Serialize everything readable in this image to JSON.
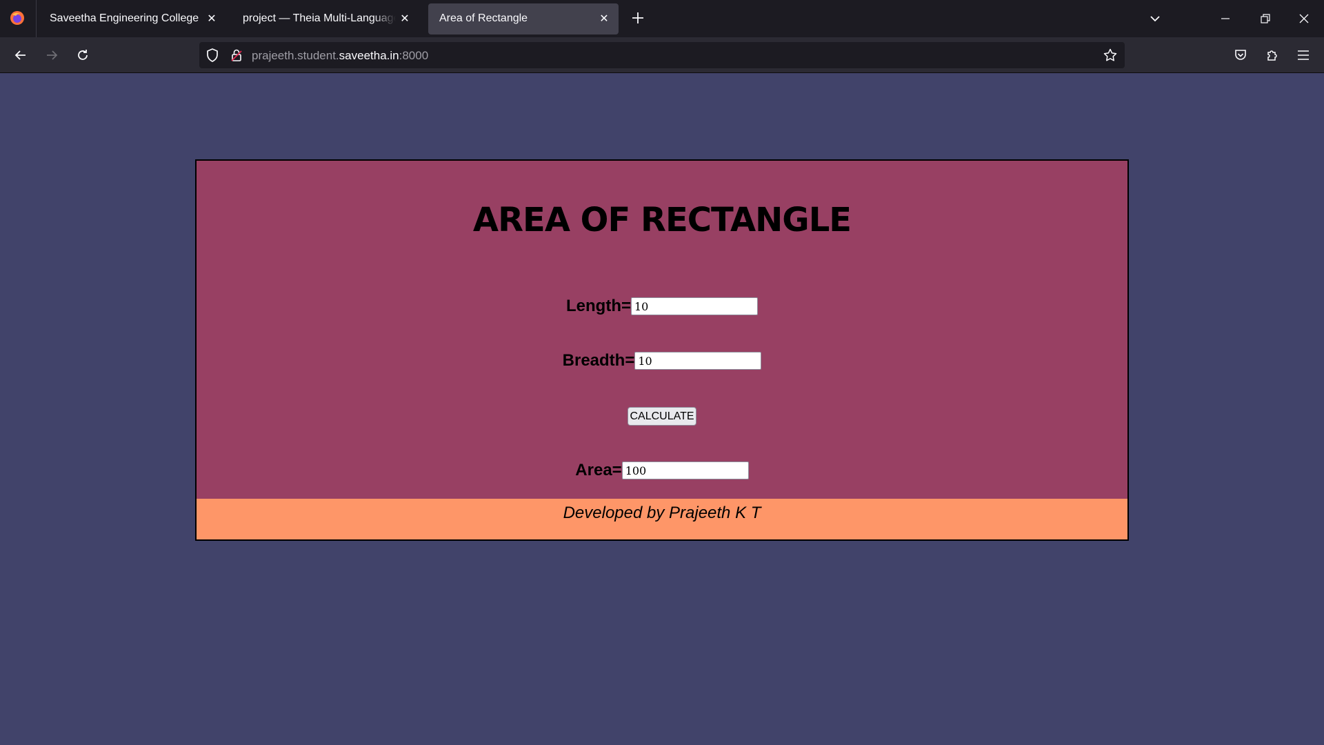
{
  "browser": {
    "tabs": [
      {
        "title": "Saveetha Engineering College",
        "active": false
      },
      {
        "title": "project — Theia Multi-Language Ex",
        "active": false
      },
      {
        "title": "Area of Rectangle",
        "active": true
      }
    ],
    "url": {
      "prefix": "prajeeth.student.",
      "domain": "saveetha.in",
      "suffix": ":8000"
    },
    "icons": {
      "logo": "firefox-logo-icon",
      "new_tab": "plus-icon",
      "list_tabs": "chevron-down-icon",
      "minimize": "minimize-icon",
      "restore": "restore-icon",
      "close": "close-icon",
      "back": "back-arrow-icon",
      "forward": "forward-arrow-icon",
      "reload": "reload-icon",
      "shield": "shield-icon",
      "lock": "lock-icon",
      "bookmark": "star-icon",
      "pocket": "pocket-icon",
      "extensions": "puzzle-icon",
      "menu": "hamburger-icon"
    }
  },
  "page": {
    "title": "AREA OF RECTANGLE",
    "length_label": "Length=",
    "length_value": "10",
    "breadth_label": "Breadth=",
    "breadth_value": "10",
    "calculate_label": "CALCULATE",
    "area_label": "Area=",
    "area_value": "100",
    "footer": "Developed by Prajeeth K T",
    "colors": {
      "background": "#41436a",
      "card": "#984063",
      "footer": "#fe9668"
    }
  }
}
